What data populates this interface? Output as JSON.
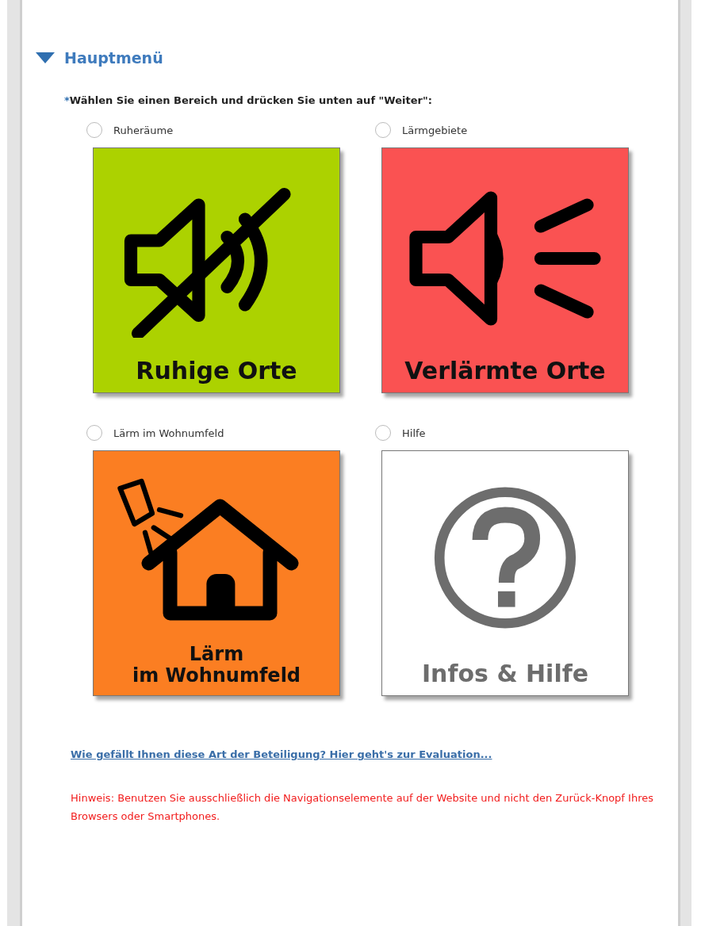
{
  "section": {
    "title": "Hauptmenü",
    "expanded": true
  },
  "prompt": {
    "required_mark": "*",
    "text": "Wählen Sie einen Bereich und drücken Sie unten auf \"Weiter\":"
  },
  "options": [
    {
      "label": "Ruheräume",
      "selected": false,
      "tile": {
        "kind": "quiet",
        "color": "#acd200",
        "caption_lines": [
          "Ruhige Orte"
        ]
      }
    },
    {
      "label": "Lärmgebiete",
      "selected": false,
      "tile": {
        "kind": "loud",
        "color": "#fa5252",
        "caption_lines": [
          "Verlärmte Orte"
        ]
      }
    },
    {
      "label": "Lärm im Wohnumfeld",
      "selected": false,
      "tile": {
        "kind": "home",
        "color": "#fb7e22",
        "caption_lines": [
          "Lärm",
          "im Wohnumfeld"
        ]
      }
    },
    {
      "label": "Hilfe",
      "selected": false,
      "tile": {
        "kind": "help",
        "color": "#ffffff",
        "caption_lines": [
          "Infos & Hilfe"
        ]
      }
    }
  ],
  "evaluation_link": "Wie gefällt Ihnen diese Art der Beteiligung? Hier geht's zur Evaluation...",
  "notice": "Hinweis: Benutzen Sie ausschließlich die Navigationselemente auf der Website und nicht den Zurück-Knopf Ihres Browsers oder Smartphones."
}
